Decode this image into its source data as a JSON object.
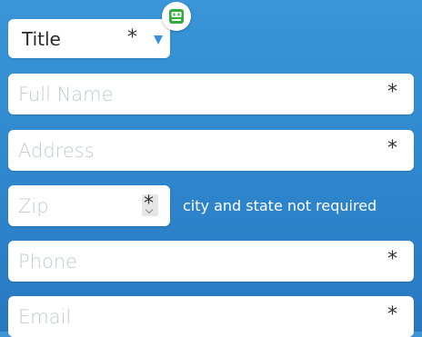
{
  "form": {
    "title_select": {
      "value": "Title",
      "required_mark": "*"
    },
    "full_name": {
      "placeholder": "Full Name",
      "required_mark": "*"
    },
    "address": {
      "placeholder": "Address",
      "required_mark": "*"
    },
    "zip": {
      "placeholder": "Zip",
      "required_mark": "*",
      "note": "city and state not required"
    },
    "phone": {
      "placeholder": "Phone",
      "required_mark": "*"
    },
    "email": {
      "placeholder": "Email",
      "required_mark": "*"
    }
  },
  "icons": {
    "badge": "robot-icon",
    "caret": "caret-down-icon",
    "stepper": "stepper-icon"
  },
  "colors": {
    "background_top": "#3a96d8",
    "background_bottom": "#2878c1",
    "caret": "#3b8fdc",
    "badge_green": "#2fae3b"
  }
}
